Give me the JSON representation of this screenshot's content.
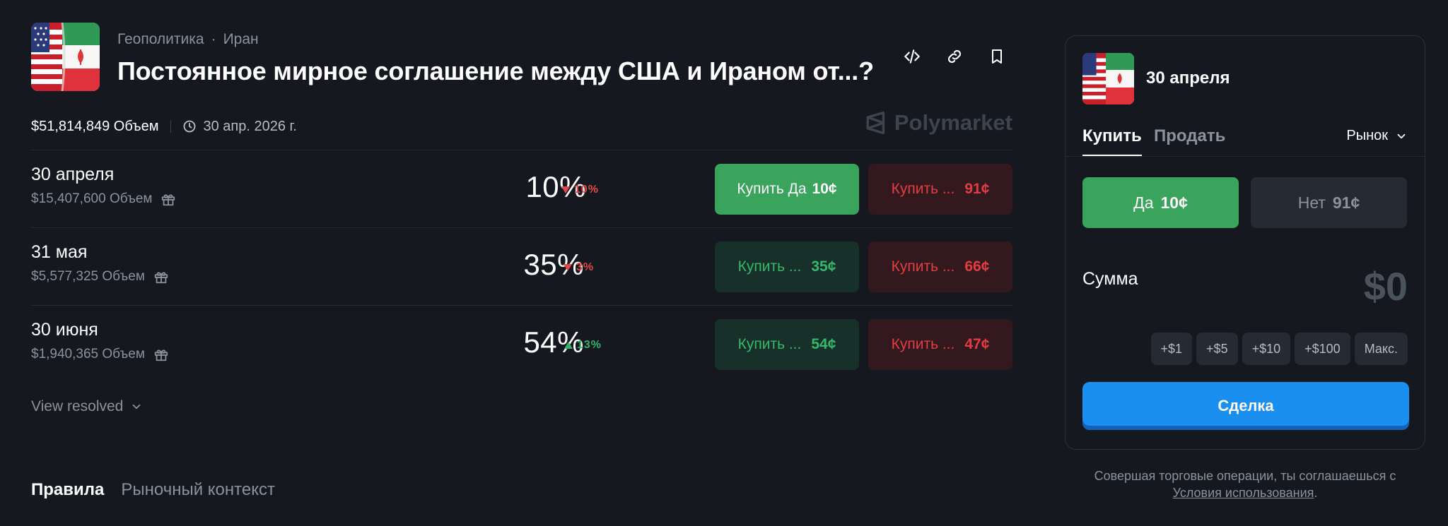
{
  "market": {
    "category": "Геополитика",
    "subcategory": "Иран",
    "breadcrumb_sep": "·",
    "title": "Постоянное мирное соглашение между США и Ираном от...?",
    "volume": "$51,814,849 Объем",
    "end_date": "30 апр. 2026 г.",
    "brand": "Polymarket"
  },
  "outcomes": [
    {
      "label": "30 апреля",
      "volume": "$15,407,600 Объем",
      "percent": "10%",
      "change": "10%",
      "change_dir": "down",
      "yes_label": "Купить Да",
      "yes_price": "10¢",
      "no_label": "Купить ...",
      "no_price": "91¢"
    },
    {
      "label": "31 мая",
      "volume": "$5,577,325 Объем",
      "percent": "35%",
      "change": "3%",
      "change_dir": "down",
      "yes_label": "Купить ...",
      "yes_price": "35¢",
      "no_label": "Купить ...",
      "no_price": "66¢"
    },
    {
      "label": "30 июня",
      "volume": "$1,940,365 Объем",
      "percent": "54%",
      "change": "13%",
      "change_dir": "up",
      "yes_label": "Купить ...",
      "yes_price": "54¢",
      "no_label": "Купить ...",
      "no_price": "47¢"
    }
  ],
  "view_resolved": "View resolved",
  "bottom_tabs": {
    "rules": "Правила",
    "context": "Рыночный контекст"
  },
  "trade_panel": {
    "title": "30 апреля",
    "tab_buy": "Купить",
    "tab_sell": "Продать",
    "order_type": "Рынок",
    "yes_label": "Да",
    "yes_price": "10¢",
    "no_label": "Нет",
    "no_price": "91¢",
    "amount_label": "Сумма",
    "amount_value": "$0",
    "quick": [
      "+$1",
      "+$5",
      "+$10",
      "+$100",
      "Макс."
    ],
    "trade_button": "Сделка"
  },
  "terms": {
    "text": "Совершая торговые операции, ты соглашаешься с",
    "link": "Условия использования",
    "end": "."
  },
  "colors": {
    "background": "#15191f",
    "yes_active": "#3aa35c",
    "yes_dim": "#18302a",
    "no_dim": "#33191e",
    "trade_blue": "#1a8ff0"
  },
  "icons": {
    "embed": "code-icon",
    "link": "link-icon",
    "bookmark": "bookmark-icon",
    "clock": "clock-icon",
    "gift": "gift-icon",
    "chevron": "chevron-down-icon"
  }
}
